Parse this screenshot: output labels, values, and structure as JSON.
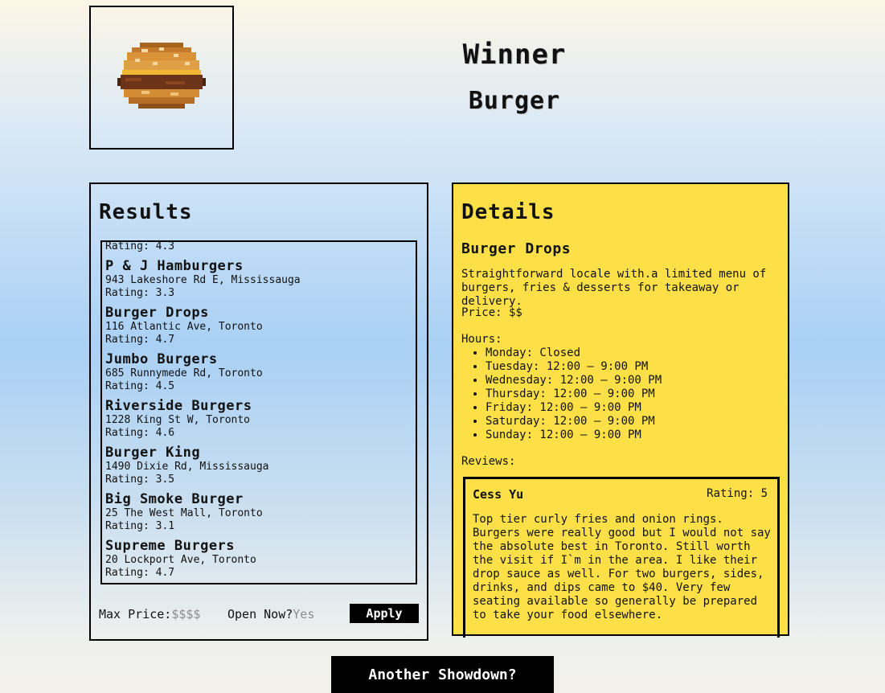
{
  "header": {
    "logo_icon": "burger-icon",
    "winner_title": "Winner",
    "winner_category": "Burger"
  },
  "results": {
    "title": "Results",
    "partial_rating": "Rating: 4.3",
    "items": [
      {
        "name": "P & J Hamburgers",
        "address": "943 Lakeshore Rd E, Mississauga",
        "rating": "Rating: 3.3"
      },
      {
        "name": "Burger Drops",
        "address": "116 Atlantic Ave, Toronto",
        "rating": "Rating: 4.7"
      },
      {
        "name": "Jumbo Burgers",
        "address": "685 Runnymede Rd, Toronto",
        "rating": "Rating: 4.5"
      },
      {
        "name": "Riverside Burgers",
        "address": "1228 King St W, Toronto",
        "rating": "Rating: 4.6"
      },
      {
        "name": "Burger King",
        "address": "1490 Dixie Rd, Mississauga",
        "rating": "Rating: 3.5"
      },
      {
        "name": "Big Smoke Burger",
        "address": "25 The West Mall, Toronto",
        "rating": "Rating: 3.1"
      },
      {
        "name": "Supreme Burgers",
        "address": "20 Lockport Ave, Toronto",
        "rating": "Rating: 4.7"
      }
    ],
    "filters": {
      "max_price_label": "Max Price:",
      "max_price_value": "$$$$",
      "open_now_label": "Open Now?",
      "open_now_value": "Yes",
      "apply_label": "Apply"
    }
  },
  "details": {
    "title": "Details",
    "name": "Burger Drops",
    "description": "Straightforward locale with.a limited menu of burgers, fries & desserts for takeaway or delivery.",
    "price": "Price: $$",
    "hours_label": "Hours:",
    "hours": [
      "Monday: Closed",
      "Tuesday: 12:00 – 9:00 PM",
      "Wednesday: 12:00 – 9:00 PM",
      "Thursday: 12:00 – 9:00 PM",
      "Friday: 12:00 – 9:00 PM",
      "Saturday: 12:00 – 9:00 PM",
      "Sunday: 12:00 – 9:00 PM"
    ],
    "reviews_label": "Reviews:",
    "review": {
      "author": "Cess Yu",
      "rating": "Rating: 5",
      "text": "Top tier curly fries and onion rings. Burgers were really good but I would not say the absolute best in Toronto. Still worth the visit if I`m in the area. I like their drop sauce as well. For two burgers, sides, drinks, and dips came to $40. Very few seating available so generally be prepared to take your food elsewhere."
    }
  },
  "footer": {
    "showdown_label": "Another Showdown?"
  },
  "colors": {
    "details_bg": "#fde047",
    "button_bg": "#000000",
    "muted": "#8c8c8c"
  }
}
